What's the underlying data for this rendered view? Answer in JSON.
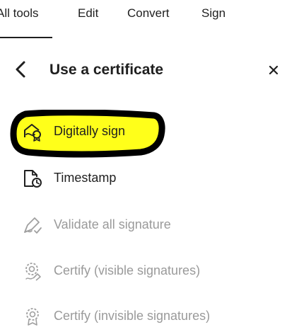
{
  "tabs": [
    {
      "label": "All tools"
    },
    {
      "label": "Edit"
    },
    {
      "label": "Convert"
    },
    {
      "label": "Sign"
    }
  ],
  "active_tab": "All tools",
  "panel": {
    "title": "Use a certificate",
    "back_icon": "chevron-left-icon",
    "close_icon": "close-icon"
  },
  "tools": [
    {
      "label": "Digitally sign",
      "icon": "certificate-sign-icon",
      "enabled": true,
      "highlighted": true
    },
    {
      "label": "Timestamp",
      "icon": "document-clock-icon",
      "enabled": true,
      "highlighted": false
    },
    {
      "label": "Validate all signature",
      "icon": "signature-check-icon",
      "enabled": false,
      "highlighted": false
    },
    {
      "label": "Certify (visible signatures)",
      "icon": "certify-visible-icon",
      "enabled": false,
      "highlighted": false
    },
    {
      "label": "Certify (invisible signatures)",
      "icon": "certify-invisible-icon",
      "enabled": false,
      "highlighted": false
    }
  ],
  "colors": {
    "highlight": "#ffff1a",
    "highlight_outline": "#000000",
    "text": "#1f1f1f",
    "disabled_text": "#9a9a9a"
  }
}
